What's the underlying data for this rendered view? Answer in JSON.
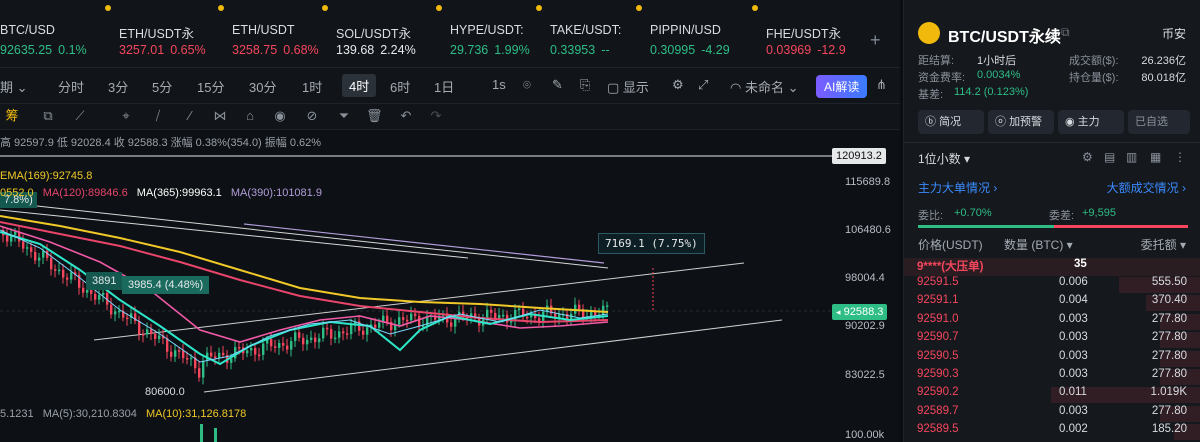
{
  "tickers": [
    {
      "sym": "BTC/USD",
      "price": "92635.25",
      "chg": "0.1%",
      "dir": "up",
      "dot": false
    },
    {
      "sym": "ETH/USDT永",
      "price": "3257.01",
      "chg": "0.65%",
      "dir": "dn",
      "dot": true
    },
    {
      "sym": "ETH/USDT",
      "price": "3258.75",
      "chg": "0.68%",
      "dir": "dn",
      "dot": true
    },
    {
      "sym": "SOL/USDT永",
      "price": "139.68",
      "chg": "2.24%",
      "dir": "neu",
      "dot": true
    },
    {
      "sym": "HYPE/USDT:",
      "price": "29.736",
      "chg": "1.99%",
      "dir": "up",
      "dot": true
    },
    {
      "sym": "TAKE/USDT:",
      "price": "0.33953",
      "chg": "--",
      "dir": "up",
      "dot": true
    },
    {
      "sym": "PIPPIN/USD",
      "price": "0.30995",
      "chg": "-4.29",
      "dir": "up",
      "dot": true
    },
    {
      "sym": "FHE/USDT永",
      "price": "0.03969",
      "chg": "-12.9",
      "dir": "dn",
      "dot": true
    }
  ],
  "intervals": {
    "period": "期",
    "items": [
      "分时",
      "3分",
      "5分",
      "15分",
      "30分",
      "1时",
      "4时",
      "6时",
      "1日"
    ],
    "active": "4时",
    "one_s": "1s",
    "display": "显示",
    "unnamed": "未命名",
    "ai": "AI解读"
  },
  "toolbar": {
    "chips_label": "筹"
  },
  "chart": {
    "stats": "高 92597.9  低 92028.4  收 92588.3  涨幅 0.38%(354.0)  振幅 0.62%",
    "ema": "EMA(169):92745.8",
    "ma_row": [
      "0552.0",
      "MA(120):89846.6",
      "MA(365):99963.1",
      "MA(390):101081.9"
    ],
    "vol_row": [
      "5.1231",
      "MA(5):30,210.8304",
      "MA(10):31,126.8178"
    ],
    "tag_left": "7.8%)",
    "annot_1": "3891",
    "annot_2": "3985.4 (4.48%)",
    "annot_3": "7169.1 (7.75%)",
    "low_label": "80600.0",
    "axis_top_box": "120913.2",
    "axis_ticks": [
      "115689.8",
      "106480.6",
      "98004.4",
      "90202.9",
      "83022.5",
      "100.00k"
    ],
    "current_price": "92588.3",
    "colors": {
      "ema169": "#f0c929",
      "ma120": "#e8456b",
      "ma365": "#ffffff",
      "ma390": "#b39ddb",
      "ma_fast": "#2ee6c9",
      "ma_mid": "#f05aa7"
    }
  },
  "panel": {
    "title": "BTC/USDT永续",
    "exchange": "币安",
    "settle_label": "距结算:",
    "settle_val": "1小时后",
    "funding_label": "资金费率:",
    "funding_val": "0.0034%",
    "basis_label": "基差:",
    "basis_val": "114.2 (0.123%)",
    "turnover_label": "成交额($):",
    "turnover_val": "26.236亿",
    "oi_label": "持仓量($):",
    "oi_val": "80.018亿",
    "buttons": [
      "简况",
      "加预警",
      "主力",
      "已自选"
    ],
    "precision": "1位小数",
    "big_orders": "主力大单情况",
    "big_trades": "大额成交情况",
    "ratio_label": "委比:",
    "ratio_val": "+0.70%",
    "diff_label": "委差:",
    "diff_val": "+9,595",
    "col_price": "价格(USDT)",
    "col_qty": "数量 (BTC)",
    "col_amt": "委托额",
    "pressure_label": "9****(大压单)",
    "pressure_qty": "35",
    "asks": [
      {
        "price": "92591.5",
        "qty": "0.006",
        "amt": "555.50"
      },
      {
        "price": "92591.1",
        "qty": "0.004",
        "amt": "370.40"
      },
      {
        "price": "92591.0",
        "qty": "0.003",
        "amt": "277.80"
      },
      {
        "price": "92590.7",
        "qty": "0.003",
        "amt": "277.80"
      },
      {
        "price": "92590.5",
        "qty": "0.003",
        "amt": "277.80"
      },
      {
        "price": "92590.3",
        "qty": "0.003",
        "amt": "277.80"
      },
      {
        "price": "92590.2",
        "qty": "0.011",
        "amt": "1.019K"
      },
      {
        "price": "92589.7",
        "qty": "0.003",
        "amt": "277.80"
      },
      {
        "price": "92589.5",
        "qty": "0.002",
        "amt": "185.20"
      }
    ]
  }
}
